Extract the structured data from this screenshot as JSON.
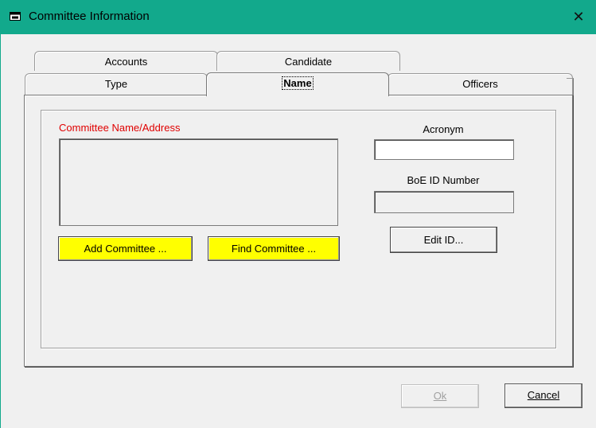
{
  "window": {
    "title": "Committee Information",
    "close_glyph": "✕",
    "accent": "#12a98c"
  },
  "tabs": {
    "back_row": [
      {
        "label": "Accounts"
      },
      {
        "label": "Candidate"
      }
    ],
    "front_row": [
      {
        "label": "Type"
      },
      {
        "label": "Name",
        "active": true
      },
      {
        "label": "Officers"
      }
    ]
  },
  "name_tab": {
    "address_label": "Committee Name/Address",
    "address_value": "",
    "add_button": "Add Committee ...",
    "find_button": "Find Committee ...",
    "acronym_label": "Acronym",
    "acronym_value": "",
    "boe_label": "BoE ID Number",
    "boe_value": "",
    "edit_id_button": "Edit ID..."
  },
  "footer": {
    "ok_label": "Ok",
    "ok_enabled": false,
    "cancel_label": "Cancel"
  },
  "colors": {
    "titlebar": "#12a98c",
    "highlight_button": "#ffff00",
    "required_label": "#e00000"
  }
}
